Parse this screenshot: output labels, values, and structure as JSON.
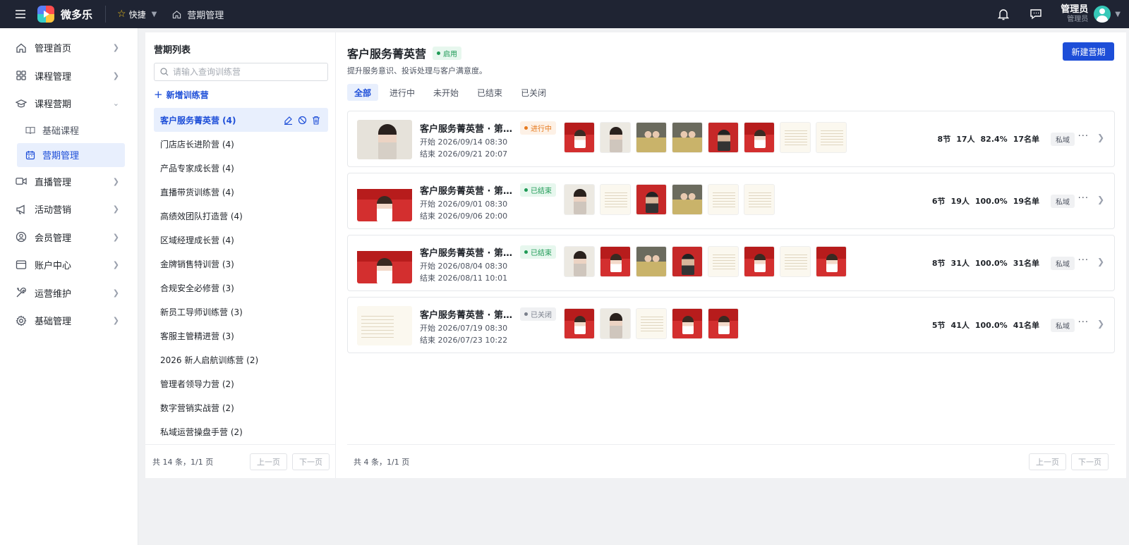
{
  "app": {
    "brand": "微多乐",
    "quick_label": "快捷",
    "breadcrumb": "营期管理"
  },
  "user": {
    "name": "管理员",
    "role": "管理员"
  },
  "sidebar": {
    "items": [
      {
        "label": "管理首页"
      },
      {
        "label": "课程管理"
      },
      {
        "label": "课程营期"
      },
      {
        "label": "直播管理"
      },
      {
        "label": "活动营销"
      },
      {
        "label": "会员管理"
      },
      {
        "label": "账户中心"
      },
      {
        "label": "运营维护"
      },
      {
        "label": "基础管理"
      }
    ],
    "sub_items": [
      {
        "label": "基础课程"
      },
      {
        "label": "营期管理"
      }
    ]
  },
  "list": {
    "title": "营期列表",
    "search_placeholder": "请输入查询训练营",
    "add_label": "新增训练营",
    "items": [
      {
        "label": "客户服务菁英营 (4)"
      },
      {
        "label": "门店店长进阶营 (4)"
      },
      {
        "label": "产品专家成长营 (4)"
      },
      {
        "label": "直播带货训练营 (4)"
      },
      {
        "label": "高绩效团队打造营 (4)"
      },
      {
        "label": "区域经理成长营 (4)"
      },
      {
        "label": "金牌销售特训营 (3)"
      },
      {
        "label": "合规安全必修营 (3)"
      },
      {
        "label": "新员工导师训练营 (3)"
      },
      {
        "label": "客服主管精进营 (3)"
      },
      {
        "label": "2026 新人启航训练营 (2)"
      },
      {
        "label": "管理者领导力营 (2)"
      },
      {
        "label": "数字营销实战营 (2)"
      },
      {
        "label": "私域运营操盘手营 (2)"
      }
    ],
    "footer": {
      "summary": "共 14 条，1/1 页",
      "prev": "上一页",
      "next": "下一页"
    }
  },
  "main": {
    "title": "客户服务菁英营",
    "status": "启用",
    "description": "提升服务意识、投诉处理与客户满意度。",
    "new_button": "新建营期",
    "tabs": [
      {
        "label": "全部"
      },
      {
        "label": "进行中"
      },
      {
        "label": "未开始"
      },
      {
        "label": "已结束"
      },
      {
        "label": "已关闭"
      }
    ],
    "sessions": [
      {
        "name": "客户服务菁英营 · 第0...",
        "status": "进行中",
        "start": "开始 2026/09/14 08:30",
        "end": "结束 2026/09/21 20:07",
        "lessons": "8节",
        "people": "17人",
        "rate": "82.4%",
        "roster": "17名单",
        "tag": "私域"
      },
      {
        "name": "客户服务菁英营 · 第0...",
        "status": "已结束",
        "start": "开始 2026/09/01 08:30",
        "end": "结束 2026/09/06 20:00",
        "lessons": "6节",
        "people": "19人",
        "rate": "100.0%",
        "roster": "19名单",
        "tag": "私域"
      },
      {
        "name": "客户服务菁英营 · 第0...",
        "status": "已结束",
        "start": "开始 2026/08/04 08:30",
        "end": "结束 2026/08/11 10:01",
        "lessons": "8节",
        "people": "31人",
        "rate": "100.0%",
        "roster": "31名单",
        "tag": "私域"
      },
      {
        "name": "客户服务菁英营 · 第0...",
        "status": "已关闭",
        "start": "开始 2026/07/19 08:30",
        "end": "结束 2026/07/23 10:22",
        "lessons": "5节",
        "people": "41人",
        "rate": "100.0%",
        "roster": "41名单",
        "tag": "私域"
      }
    ],
    "footer": {
      "summary": "共 4 条，1/1 页",
      "prev": "上一页",
      "next": "下一页"
    }
  },
  "colors": {
    "accent": "#1d4ed8",
    "topbar": "#1f2433",
    "in_progress": "#e67a1f",
    "ended": "#1e9a55",
    "closed": "#7a808c"
  }
}
